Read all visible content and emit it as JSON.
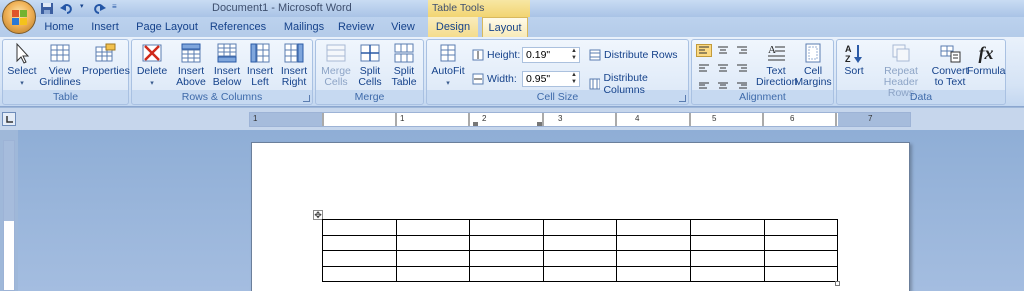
{
  "window": {
    "title": "Document1 - Microsoft Word",
    "context_tab_group": "Table Tools"
  },
  "tabs": [
    {
      "label": "Home"
    },
    {
      "label": "Insert"
    },
    {
      "label": "Page Layout"
    },
    {
      "label": "References"
    },
    {
      "label": "Mailings"
    },
    {
      "label": "Review"
    },
    {
      "label": "View"
    },
    {
      "label": "Design"
    },
    {
      "label": "Layout"
    }
  ],
  "active_tab": "Layout",
  "ribbon": {
    "table": {
      "label": "Table",
      "select": "Select",
      "view_gridlines_1": "View",
      "view_gridlines_2": "Gridlines",
      "properties": "Properties"
    },
    "rows_columns": {
      "label": "Rows & Columns",
      "delete": "Delete",
      "insert_above_1": "Insert",
      "insert_above_2": "Above",
      "insert_below_1": "Insert",
      "insert_below_2": "Below",
      "insert_left_1": "Insert",
      "insert_left_2": "Left",
      "insert_right_1": "Insert",
      "insert_right_2": "Right"
    },
    "merge": {
      "label": "Merge",
      "merge_cells_1": "Merge",
      "merge_cells_2": "Cells",
      "split_cells_1": "Split",
      "split_cells_2": "Cells",
      "split_table_1": "Split",
      "split_table_2": "Table"
    },
    "cell_size": {
      "label": "Cell Size",
      "autofit": "AutoFit",
      "height_label": "Height:",
      "height_value": "0.19\"",
      "width_label": "Width:",
      "width_value": "0.95\"",
      "distribute_rows": "Distribute Rows",
      "distribute_columns": "Distribute Columns"
    },
    "alignment": {
      "label": "Alignment",
      "text_direction_1": "Text",
      "text_direction_2": "Direction",
      "cell_margins_1": "Cell",
      "cell_margins_2": "Margins"
    },
    "data": {
      "label": "Data",
      "sort": "Sort",
      "repeat_header_1": "Repeat",
      "repeat_header_2": "Header Rows",
      "convert_1": "Convert",
      "convert_2": "to Text",
      "formula": "Formula",
      "formula_glyph": "fx"
    }
  },
  "ruler": {
    "numbers": [
      "1",
      "1",
      "2",
      "3",
      "4",
      "5",
      "6",
      "7"
    ]
  },
  "document": {
    "table_rows": 4,
    "table_cols": 7
  },
  "colors": {
    "accent": "#15428b",
    "context_tab": "#f4dc8c",
    "ribbon_bg": "#dfeaf8"
  }
}
